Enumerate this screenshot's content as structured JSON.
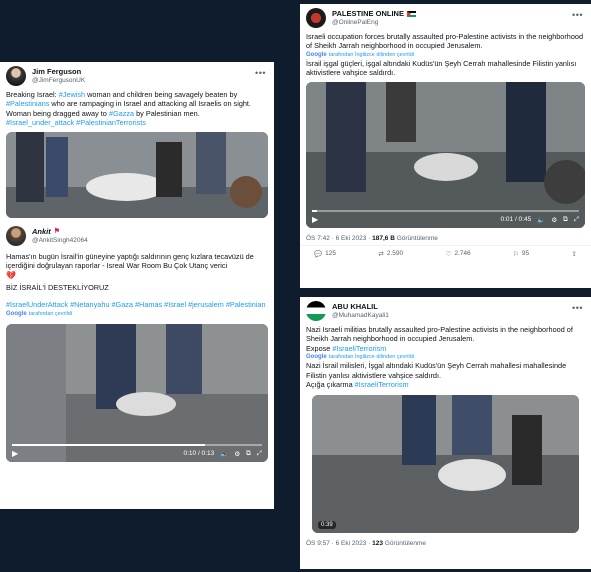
{
  "card1": {
    "tweet1": {
      "name": "Jim Ferguson",
      "handle": "@JimFergusonUK",
      "text_plain1": "Breaking Israel: ",
      "tag1": "#Jewish",
      "text_plain2": " woman and children being savagely beaten by ",
      "tag2": "#Palestinians",
      "text_plain3": " who are rampaging in Israel and attacking all Israelis on sight. Woman being dragged away to ",
      "tag3": "#Gazza",
      "text_plain4": " by Palestinian men.",
      "tag4": "#Israel_under_attack #PalestinianTerrorists"
    },
    "tweet2": {
      "name": "Ankit",
      "handle": "@AnkitSingh42064",
      "text": "Hamas'ın bugün İsrail'in güneyine yaptığı saldırının genç kızlara tecavüzü de içerdiğini doğrulayan raporlar - Isreal War Room Bu Çok Utanç verici",
      "heart": "💔",
      "text2": "BİZ İSRAİL'İ DESTEKLİYORUZ",
      "tags": "#IsraelUnderAttack #Netanyahu #Gaza #Hamas #Israel #jerusalem #Palestinian",
      "translated": "tarafından çevrildi",
      "google": "Google",
      "time": "0:10 / 0:13"
    }
  },
  "card2": {
    "name": "PALESTINE ONLINE",
    "handle": "@OnlinePalEng",
    "text": "Israeli occupation forces brutally assaulted pro-Palestine activists in the neighborhood of Sheikh Jarrah neighborhood in occupied Jerusalem.",
    "google": "Google",
    "translated": "tarafından İngilizce dilinden çevrildi",
    "text_tr": "İsrail işgal güçleri, işgal altındaki Kudüs'ün Şeyh Cerrah mahallesinde Filistin yanlısı aktivistlere vahşice saldırdı.",
    "time": "0:01 / 0:45",
    "meta_time": "ÖS 7:42 · 6 Eki 2023 · ",
    "views": "187,6 B",
    "views_label": " Görüntülenme",
    "replies": "125",
    "retweets": "2.590",
    "likes": "2.746",
    "bookmarks": "95"
  },
  "card3": {
    "name": "ABU KHALIL",
    "handle": "@MuhamadKayali1",
    "text": "Nazi Israeli militias brutally assaulted pro-Palestine activists in the neighborhood of Sheikh Jarrah neighborhood in occupied Jerusalem.",
    "expose": "Expose ",
    "expose_tag": "#IsraeliTerrorism",
    "google": "Google",
    "translated": "tarafından İngilizce dilinden çevrildi",
    "text_tr": "Nazi İsrail milisleri, İşgal altındaki Kudüs'ün Şeyh Cerrah mahallesi mahallesinde Filistin yanlısı aktivistlere vahşice saldırdı.",
    "expose_tr": "Açığa çıkarma ",
    "expose_tag_tr": "#IsraeliTerrorism",
    "video_time": "0:39",
    "meta_time": "ÖS 9:57 · 6 Eki 2023 · ",
    "views": "123",
    "views_label": " Görüntülenme"
  },
  "colors": {
    "background": "#0f1c2e",
    "link": "#1d9bf0",
    "text": "#0f1419",
    "muted": "#536471"
  },
  "icons": [
    "more-icon",
    "play-icon",
    "volume-icon",
    "settings-icon",
    "pip-icon",
    "fullscreen-icon",
    "reply-icon",
    "retweet-icon",
    "like-icon",
    "bookmark-icon",
    "share-icon"
  ]
}
